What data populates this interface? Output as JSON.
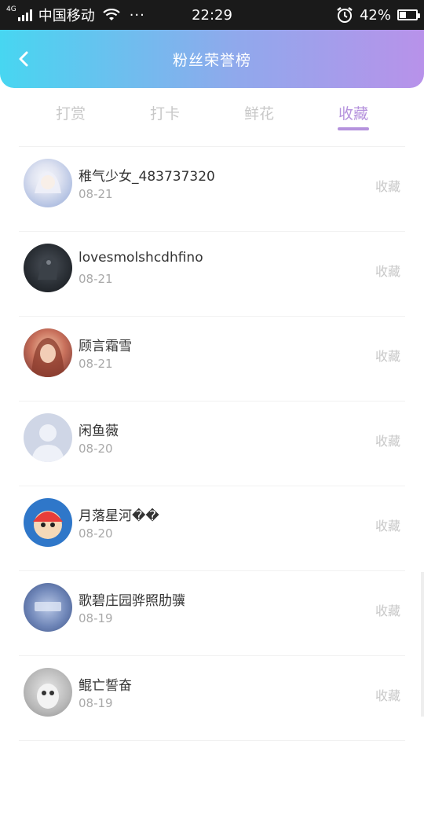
{
  "status_bar": {
    "network": "4G",
    "carrier": "中国移动",
    "more": "···",
    "time": "22:29",
    "battery_percent": "42%",
    "battery_level": 0.42
  },
  "header": {
    "title": "粉丝荣誉榜",
    "back_icon": "chevron-left-icon"
  },
  "tabs": [
    {
      "label": "打赏",
      "active": false
    },
    {
      "label": "打卡",
      "active": false
    },
    {
      "label": "鲜花",
      "active": false
    },
    {
      "label": "收藏",
      "active": true
    }
  ],
  "colors": {
    "accent": "#b592dd",
    "header_start": "#47d6f1",
    "header_end": "#b892ea"
  },
  "items": [
    {
      "name": "稚气少女_483737320",
      "date": "08-21",
      "type": "收藏"
    },
    {
      "name": "lovesmolshcdhfino",
      "date": "08-21",
      "type": "收藏"
    },
    {
      "name": "顾言霜雪",
      "date": "08-21",
      "type": "收藏"
    },
    {
      "name": "闲鱼薇",
      "date": "08-20",
      "type": "收藏"
    },
    {
      "name": "月落星河��",
      "date": "08-20",
      "type": "收藏"
    },
    {
      "name": "歌碧庄园骅照肋骥",
      "date": "08-19",
      "type": "收藏"
    },
    {
      "name": "鲲亡誓奋",
      "date": "08-19",
      "type": "收藏"
    }
  ]
}
